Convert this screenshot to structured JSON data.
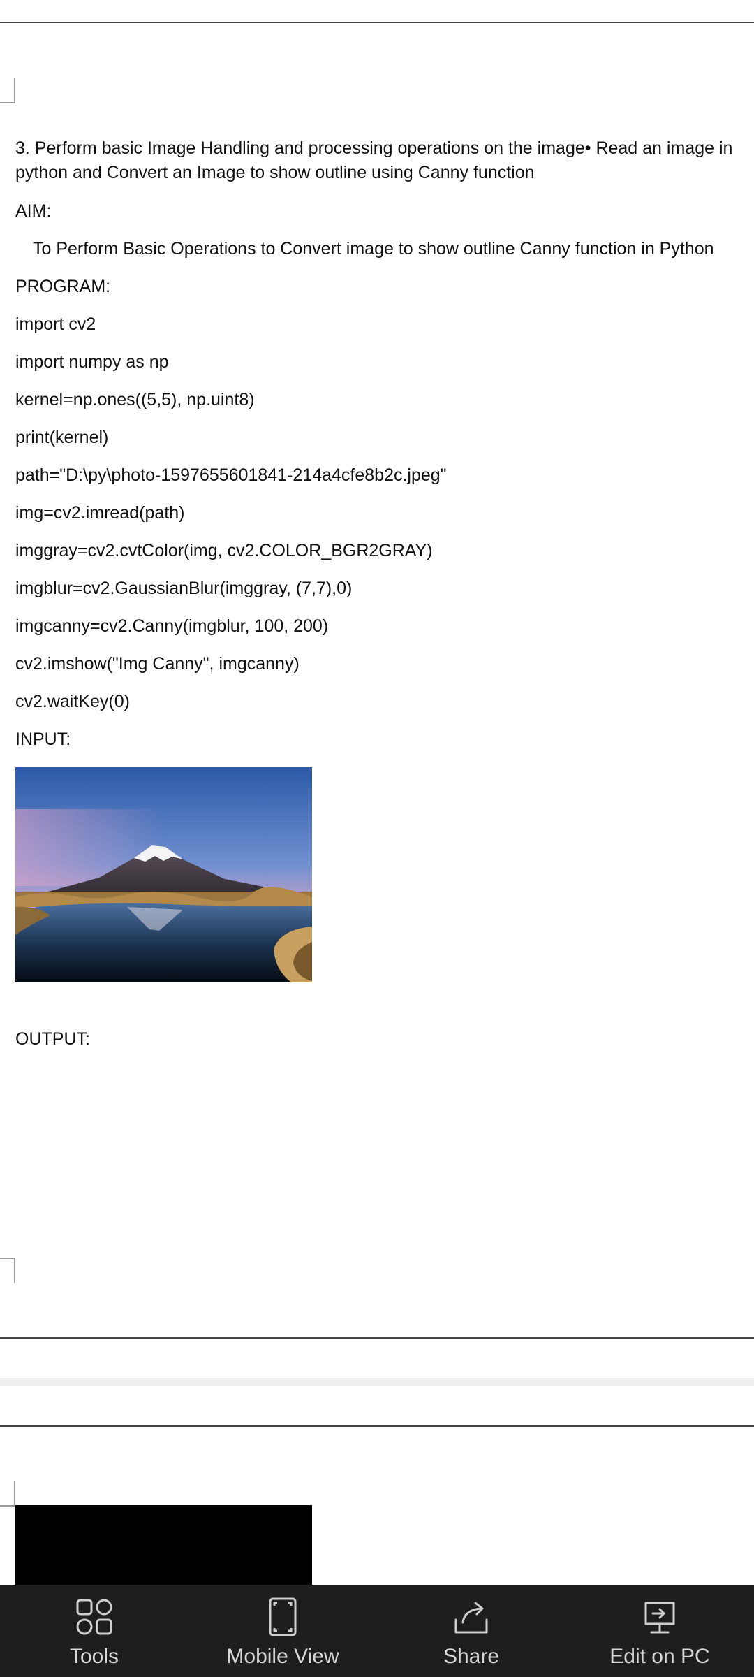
{
  "document": {
    "heading": "3. Perform basic Image Handling and processing operations on the image• Read an image in python and Convert an Image to show outline using Canny function",
    "aim_label": "AIM:",
    "aim_text": "To Perform Basic Operations to Convert image to show outline Canny function in Python",
    "program_label": "PROGRAM:",
    "code_lines": [
      "import cv2",
      "import numpy as np",
      "kernel=np.ones((5,5), np.uint8)",
      "print(kernel)",
      "path=\"D:\\py\\photo-1597655601841-214a4cfe8b2c.jpeg\"",
      "img=cv2.imread(path)",
      "imggray=cv2.cvtColor(img, cv2.COLOR_BGR2GRAY)",
      "imgblur=cv2.GaussianBlur(imggray, (7,7),0)",
      "imgcanny=cv2.Canny(imgblur, 100, 200)",
      "cv2.imshow(\"Img Canny\", imgcanny)",
      "cv2.waitKey(0)"
    ],
    "input_label": "INPUT:",
    "output_label": "OUTPUT:"
  },
  "bottom_bar": {
    "items": [
      {
        "label": "Tools",
        "icon": "tools-icon"
      },
      {
        "label": "Mobile View",
        "icon": "mobile-view-icon"
      },
      {
        "label": "Share",
        "icon": "share-icon"
      },
      {
        "label": "Edit on PC",
        "icon": "edit-on-pc-icon"
      }
    ]
  },
  "colors": {
    "bar_background": "#1e1e1e",
    "bar_text": "#d8d8d8",
    "text": "#111111"
  }
}
